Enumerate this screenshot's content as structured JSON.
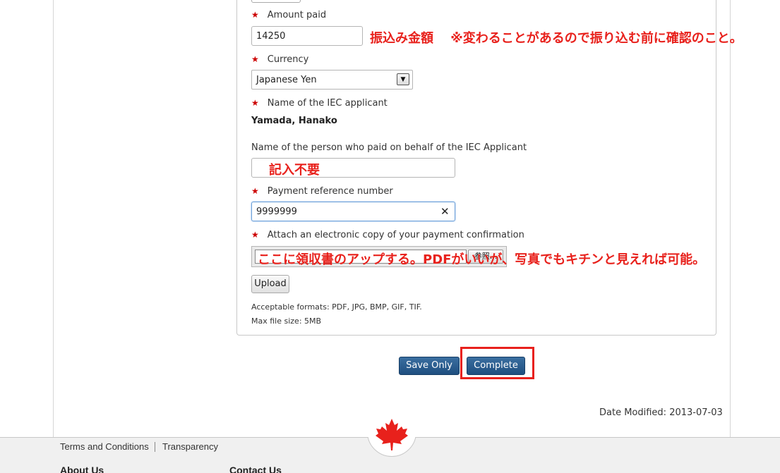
{
  "form": {
    "amount_label": "Amount paid",
    "amount_value": "14250",
    "currency_label": "Currency",
    "currency_value": "Japanese Yen",
    "applicant_label": "Name of the IEC applicant",
    "applicant_name": "Yamada, Hanako",
    "payer_label": "Name of the person who paid on behalf of the IEC Applicant",
    "payer_value": "",
    "reference_label": "Payment reference number",
    "reference_value": "9999999",
    "attach_label": "Attach an electronic copy of your payment confirmation",
    "browse_label": "参照...",
    "upload_label": "Upload",
    "formats_note": "Acceptable formats: PDF, JPG, BMP, GIF, TIF.",
    "size_note": "Max file size: 5MB",
    "required_mark": "★"
  },
  "annotations": {
    "amount_note": "振込み金額　 ※変わることがあるので振り込む前に確認のこと。",
    "payer_note": "記入不要",
    "attach_note": "ここに領収書のアップする。PDFがいいが、写真でもキチンと見えれば可能。"
  },
  "actions": {
    "save_label": "Save Only",
    "complete_label": "Complete"
  },
  "meta": {
    "date_modified": "Date Modified: 2013-07-03"
  },
  "footer": {
    "terms": "Terms and Conditions",
    "transparency": "Transparency",
    "about": "About Us",
    "contact": "Contact Us"
  },
  "colors": {
    "annotation_red": "#e8211c",
    "button_blue": "#1f4f80",
    "maple_red": "#e8211c"
  }
}
